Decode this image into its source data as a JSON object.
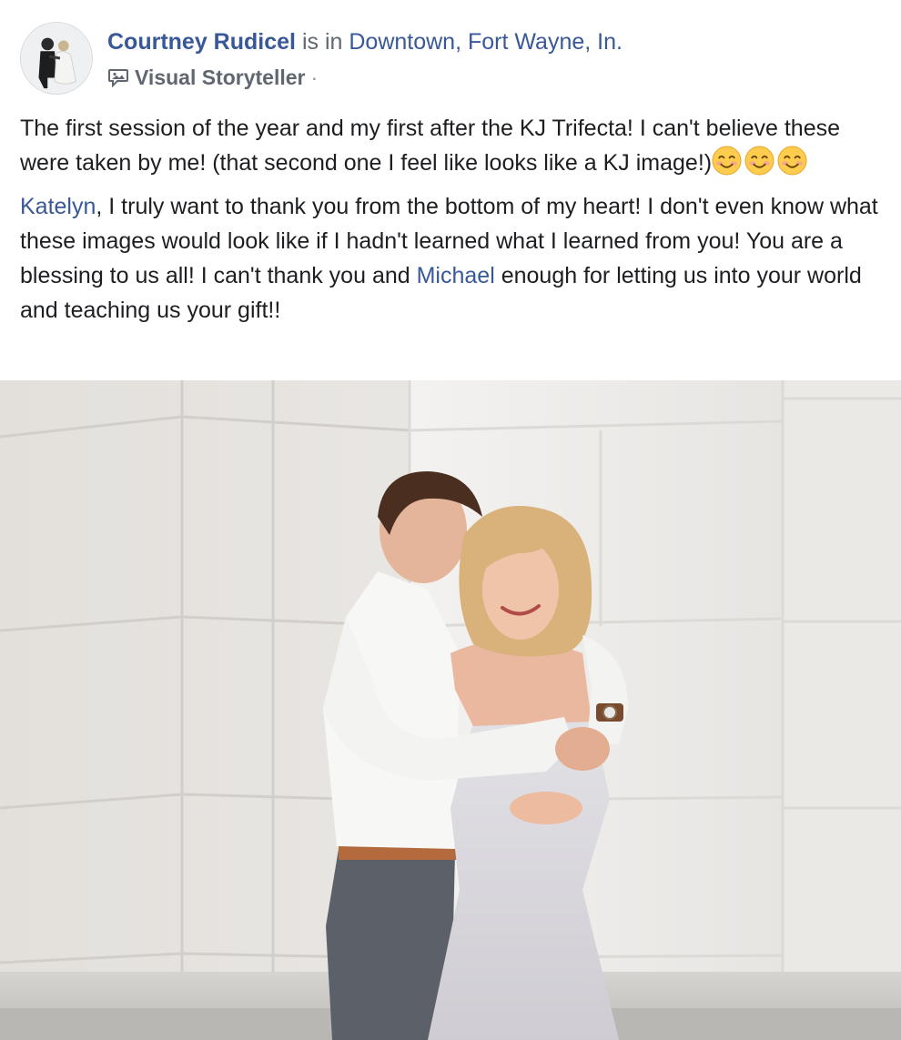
{
  "post": {
    "author": "Courtney Rudicel",
    "checkin_prefix": "is in",
    "location": "Downtown, Fort Wayne, In.",
    "badge": {
      "icon": "speech-bubble-image-icon",
      "label": "Visual Storyteller",
      "separator": "·"
    },
    "paragraph1": "The first session of the year and my first after the KJ Trifecta! I can't believe these were taken by me! (that second one I feel like looks like a KJ image!)",
    "emojis": [
      "smiling-face-icon",
      "smiling-face-icon",
      "smiling-face-icon"
    ],
    "paragraph2": {
      "mention1": "Katelyn",
      "text1": ", I truly want to thank you from the bottom of my heart! I don't even know what these images would look like if I hadn't learned what I learned from you! You are a blessing to us all! I can't thank you and ",
      "mention2": "Michael",
      "text2": " enough for letting us into your world and teaching us your gift!!"
    }
  },
  "colors": {
    "link": "#385898",
    "text": "#1c1e21",
    "secondary": "#616770"
  }
}
